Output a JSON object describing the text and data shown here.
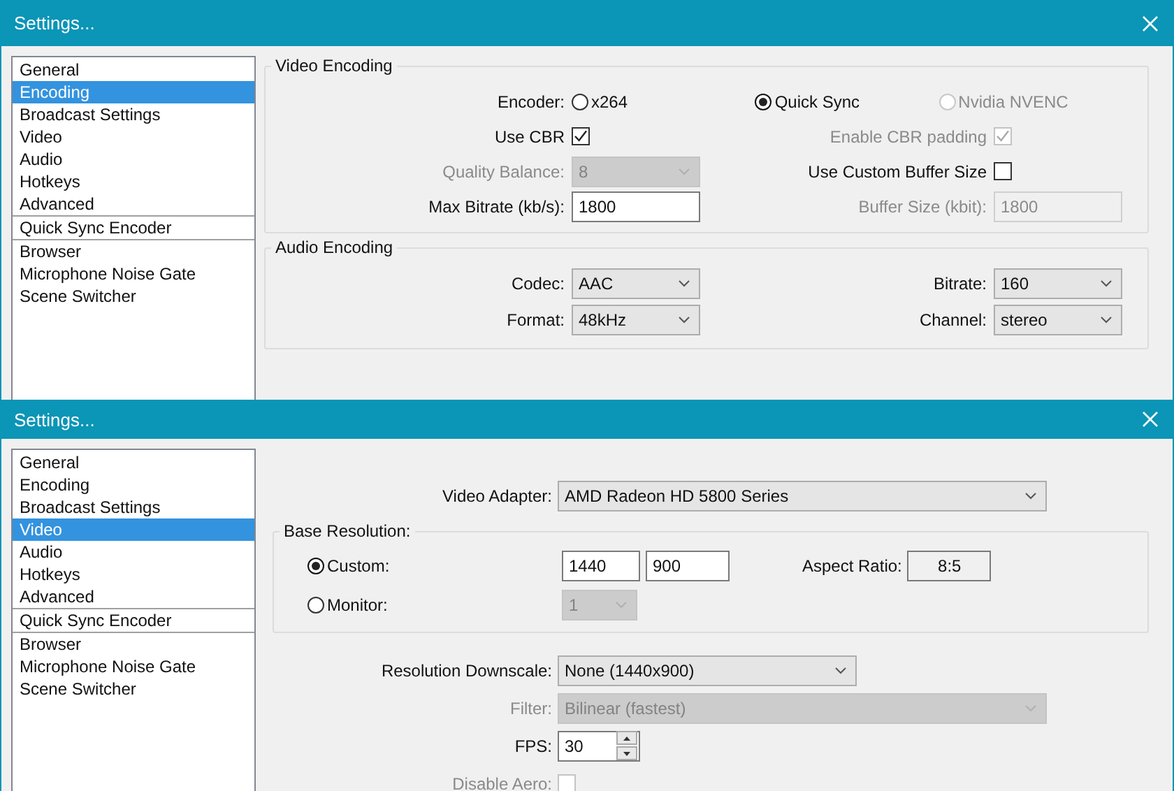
{
  "encoding_window": {
    "title": "Settings...",
    "sidebar": {
      "groups": [
        [
          {
            "label": "General",
            "selected": false
          },
          {
            "label": "Encoding",
            "selected": true
          },
          {
            "label": "Broadcast Settings",
            "selected": false
          },
          {
            "label": "Video",
            "selected": false
          },
          {
            "label": "Audio",
            "selected": false
          },
          {
            "label": "Hotkeys",
            "selected": false
          },
          {
            "label": "Advanced",
            "selected": false
          }
        ],
        [
          {
            "label": "Quick Sync Encoder",
            "selected": false
          }
        ],
        [
          {
            "label": "Browser",
            "selected": false
          },
          {
            "label": "Microphone Noise Gate",
            "selected": false
          },
          {
            "label": "Scene Switcher",
            "selected": false
          }
        ]
      ]
    },
    "groups": [
      {
        "title": "Video Encoding",
        "rows": [
          [
            {
              "kind": "radio_group",
              "label": "Encoder:",
              "options": [
                {
                  "label": "x264",
                  "selected": false,
                  "disabled": false
                },
                {
                  "label": "Quick Sync",
                  "selected": true,
                  "disabled": false
                },
                {
                  "label": "Nvidia NVENC",
                  "selected": false,
                  "disabled": true
                }
              ]
            }
          ],
          [
            {
              "kind": "checkbox",
              "label": "Use CBR",
              "checked": true,
              "disabled": false
            },
            {
              "kind": "checkbox",
              "label": "Enable CBR padding",
              "checked": true,
              "disabled": true
            }
          ],
          [
            {
              "kind": "select",
              "label": "Quality Balance:",
              "value": "8",
              "disabled": true
            },
            {
              "kind": "checkbox",
              "label": "Use Custom Buffer Size",
              "checked": false,
              "disabled": false
            }
          ],
          [
            {
              "kind": "text",
              "label": "Max Bitrate (kb/s):",
              "value": "1800",
              "disabled": false
            },
            {
              "kind": "text",
              "label": "Buffer Size (kbit):",
              "value": "1800",
              "disabled": true
            }
          ]
        ]
      },
      {
        "title": "Audio Encoding",
        "rows": [
          [
            {
              "kind": "select",
              "label": "Codec:",
              "value": "AAC",
              "disabled": false
            },
            {
              "kind": "select",
              "label": "Bitrate:",
              "value": "160",
              "disabled": false
            }
          ],
          [
            {
              "kind": "select",
              "label": "Format:",
              "value": "48kHz",
              "disabled": false
            },
            {
              "kind": "select",
              "label": "Channel:",
              "value": "stereo",
              "disabled": false
            }
          ]
        ]
      }
    ]
  },
  "video_window": {
    "title": "Settings...",
    "sidebar": {
      "groups": [
        [
          {
            "label": "General",
            "selected": false
          },
          {
            "label": "Encoding",
            "selected": false
          },
          {
            "label": "Broadcast Settings",
            "selected": false
          },
          {
            "label": "Video",
            "selected": true
          },
          {
            "label": "Audio",
            "selected": false
          },
          {
            "label": "Hotkeys",
            "selected": false
          },
          {
            "label": "Advanced",
            "selected": false
          }
        ],
        [
          {
            "label": "Quick Sync Encoder",
            "selected": false
          }
        ],
        [
          {
            "label": "Browser",
            "selected": false
          },
          {
            "label": "Microphone Noise Gate",
            "selected": false
          },
          {
            "label": "Scene Switcher",
            "selected": false
          }
        ]
      ]
    },
    "adapter": {
      "kind": "select",
      "label": "Video Adapter:",
      "value": "AMD Radeon HD 5800 Series",
      "disabled": false
    },
    "base_resolution": {
      "title": "Base Resolution:",
      "options": [
        {
          "label": "Custom:",
          "selected": true,
          "fields": [
            {
              "kind": "text",
              "value": "1440",
              "disabled": false
            },
            {
              "kind": "text",
              "value": "900",
              "disabled": false
            },
            {
              "kind": "readonly",
              "label": "Aspect Ratio:",
              "value": "8:5",
              "disabled": false
            }
          ]
        },
        {
          "label": "Monitor:",
          "selected": false,
          "fields": [
            {
              "kind": "select",
              "value": "1",
              "disabled": true
            }
          ]
        }
      ]
    },
    "fields": [
      {
        "kind": "select",
        "label": "Resolution Downscale:",
        "value": "None  (1440x900)",
        "disabled": false
      },
      {
        "kind": "select",
        "label": "Filter:",
        "value": "Bilinear (fastest)",
        "disabled": true
      },
      {
        "kind": "spin",
        "label": "FPS:",
        "value": "30",
        "disabled": false
      },
      {
        "kind": "checkbox",
        "label": "Disable Aero:",
        "checked": false,
        "disabled": true
      }
    ]
  }
}
